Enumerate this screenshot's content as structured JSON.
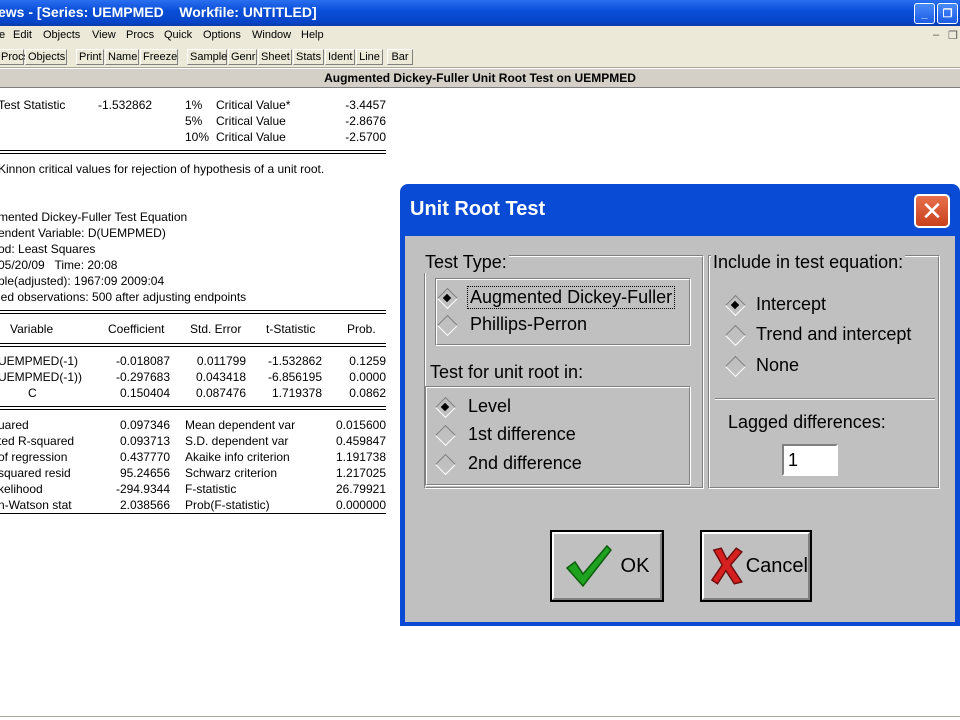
{
  "window": {
    "title": "ews - [Series: UEMPMED    Workfile: UNTITLED]"
  },
  "menu": [
    "e",
    "Edit",
    "Objects",
    "View",
    "Procs",
    "Quick",
    "Options",
    "Window",
    "Help"
  ],
  "toolbar": [
    "Procs",
    "Objects",
    "Print",
    "Name",
    "Freeze",
    "Sample",
    "Genr",
    "Sheet",
    "Stats",
    "Ident",
    "Line",
    "Bar"
  ],
  "output": {
    "header": "Augmented Dickey-Fuller Unit Root Test on UEMPMED",
    "test_stat_label": "Test Statistic",
    "test_stat_value": "-1.532862",
    "critical": [
      {
        "pct": "1%",
        "label": "Critical Value*",
        "value": "-3.4457"
      },
      {
        "pct": "5%",
        "label": "Critical Value",
        "value": "-2.8676"
      },
      {
        "pct": "10%",
        "label": "Critical Value",
        "value": "-2.5700"
      }
    ],
    "mackinnon_note": "Kinnon critical values for rejection of hypothesis of a unit root.",
    "equation_info": [
      "mented Dickey-Fuller Test Equation",
      "endent Variable: D(UEMPMED)",
      "od: Least Squares",
      "05/20/09   Time: 20:08",
      "ple(adjusted): 1967:09 2009:04",
      "led observations: 500 after adjusting endpoints"
    ],
    "coef_headers": [
      "Variable",
      "Coefficient",
      "Std. Error",
      "t-Statistic",
      "Prob."
    ],
    "coef_rows": [
      [
        "UEMPMED(-1)",
        "-0.018087",
        "0.011799",
        "-1.532862",
        "0.1259"
      ],
      [
        "UEMPMED(-1))",
        "-0.297683",
        "0.043418",
        "-6.856195",
        "0.0000"
      ],
      [
        "C",
        "0.150404",
        "0.087476",
        "1.719378",
        "0.0862"
      ]
    ],
    "stats_rows": [
      [
        "uared",
        "0.097346",
        "Mean dependent var",
        "0.015600"
      ],
      [
        "ted R-squared",
        "0.093713",
        "S.D. dependent var",
        "0.459847"
      ],
      [
        "of regression",
        "0.437770",
        "Akaike info criterion",
        "1.191738"
      ],
      [
        "squared resid",
        "95.24656",
        "Schwarz criterion",
        "1.217025"
      ],
      [
        "kelihood",
        "-294.9344",
        "F-statistic",
        "26.79921"
      ],
      [
        "n-Watson stat",
        "2.038566",
        "Prob(F-statistic)",
        "0.000000"
      ]
    ]
  },
  "dialog": {
    "title": "Unit Root Test",
    "test_type_label": "Test Type:",
    "test_type_options": [
      "Augmented Dickey-Fuller",
      "Phillips-Perron"
    ],
    "test_type_selected": 0,
    "unit_root_label": "Test for unit root in:",
    "unit_root_options": [
      "Level",
      "1st difference",
      "2nd difference"
    ],
    "unit_root_selected": 0,
    "include_label": "Include in test equation:",
    "include_options": [
      "Intercept",
      "Trend and intercept",
      "None"
    ],
    "include_selected": 0,
    "lag_label": "Lagged differences:",
    "lag_value": "1",
    "ok_label": "OK",
    "cancel_label": "Cancel"
  }
}
